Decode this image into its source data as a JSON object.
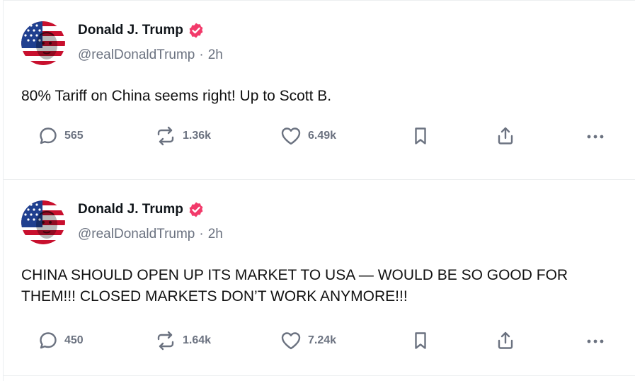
{
  "posts": [
    {
      "author": "Donald J. Trump",
      "handle": "@realDonaldTrump",
      "separator": "·",
      "time": "2h",
      "text": "80% Tariff on China seems right! Up to Scott B.",
      "replies": "565",
      "reposts": "1.36k",
      "likes": "6.49k"
    },
    {
      "author": "Donald J. Trump",
      "handle": "@realDonaldTrump",
      "separator": "·",
      "time": "2h",
      "text": "CHINA SHOULD OPEN UP ITS MARKET TO USA — WOULD BE SO GOOD FOR THEM!!! CLOSED MARKETS DON’T WORK ANYMORE!!!",
      "replies": "450",
      "reposts": "1.64k",
      "likes": "7.24k"
    }
  ],
  "icons": {
    "verified": "verified-badge-icon",
    "reply": "comment-bubble-icon",
    "repost": "repost-arrows-icon",
    "like": "heart-icon",
    "bookmark": "bookmark-icon",
    "share": "share-upload-icon",
    "more": "more-dots-icon"
  },
  "colors": {
    "verified": "#f23a6a",
    "icon_gray": "#6b7280",
    "text": "#0f1419"
  }
}
